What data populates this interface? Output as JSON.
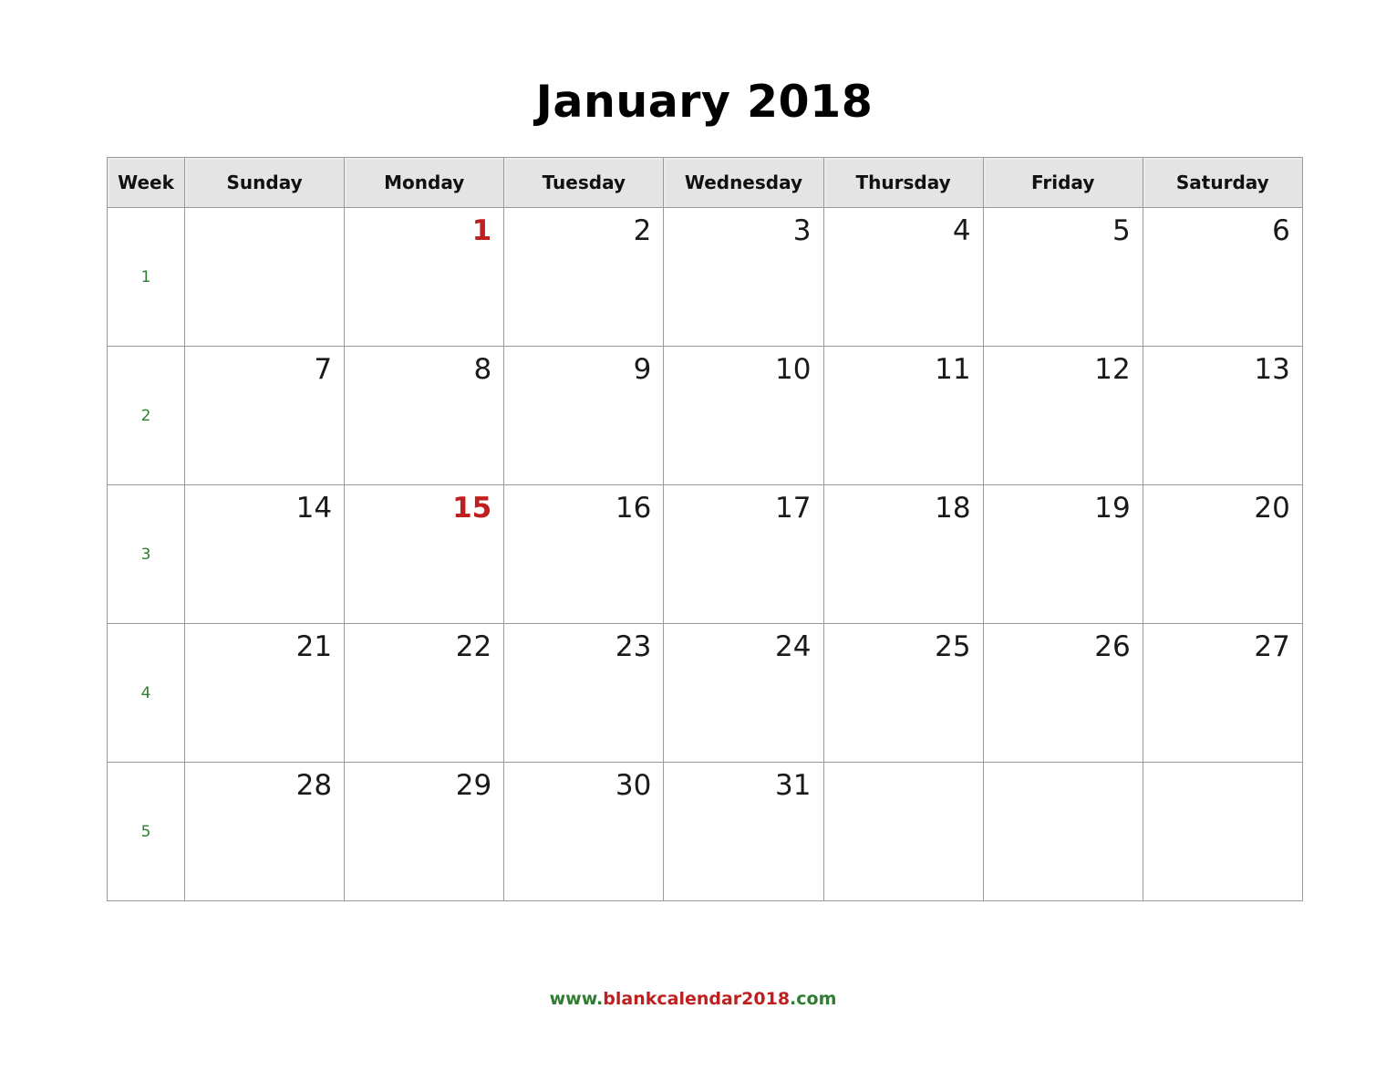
{
  "title": "January 2018",
  "header": {
    "week_label": "Week",
    "days": [
      "Sunday",
      "Monday",
      "Tuesday",
      "Wednesday",
      "Thursday",
      "Friday",
      "Saturday"
    ]
  },
  "colors": {
    "holiday": "#bf1f1f",
    "week_number": "#2f7d32",
    "day_number": "#1a1a1a",
    "header_background": "#e4e4e4",
    "grid_border": "#9a9a9a"
  },
  "weeks": [
    {
      "number": "1",
      "days": [
        {
          "num": "",
          "holiday": false
        },
        {
          "num": "1",
          "holiday": true
        },
        {
          "num": "2",
          "holiday": false
        },
        {
          "num": "3",
          "holiday": false
        },
        {
          "num": "4",
          "holiday": false
        },
        {
          "num": "5",
          "holiday": false
        },
        {
          "num": "6",
          "holiday": false
        }
      ]
    },
    {
      "number": "2",
      "days": [
        {
          "num": "7",
          "holiday": false
        },
        {
          "num": "8",
          "holiday": false
        },
        {
          "num": "9",
          "holiday": false
        },
        {
          "num": "10",
          "holiday": false
        },
        {
          "num": "11",
          "holiday": false
        },
        {
          "num": "12",
          "holiday": false
        },
        {
          "num": "13",
          "holiday": false
        }
      ]
    },
    {
      "number": "3",
      "days": [
        {
          "num": "14",
          "holiday": false
        },
        {
          "num": "15",
          "holiday": true
        },
        {
          "num": "16",
          "holiday": false
        },
        {
          "num": "17",
          "holiday": false
        },
        {
          "num": "18",
          "holiday": false
        },
        {
          "num": "19",
          "holiday": false
        },
        {
          "num": "20",
          "holiday": false
        }
      ]
    },
    {
      "number": "4",
      "days": [
        {
          "num": "21",
          "holiday": false
        },
        {
          "num": "22",
          "holiday": false
        },
        {
          "num": "23",
          "holiday": false
        },
        {
          "num": "24",
          "holiday": false
        },
        {
          "num": "25",
          "holiday": false
        },
        {
          "num": "26",
          "holiday": false
        },
        {
          "num": "27",
          "holiday": false
        }
      ]
    },
    {
      "number": "5",
      "days": [
        {
          "num": "28",
          "holiday": false
        },
        {
          "num": "29",
          "holiday": false
        },
        {
          "num": "30",
          "holiday": false
        },
        {
          "num": "31",
          "holiday": false
        },
        {
          "num": "",
          "holiday": false
        },
        {
          "num": "",
          "holiday": false
        },
        {
          "num": "",
          "holiday": false
        }
      ]
    }
  ],
  "footer": {
    "prefix": "www.",
    "domain": "blankcalendar2018",
    "suffix": ".com"
  }
}
